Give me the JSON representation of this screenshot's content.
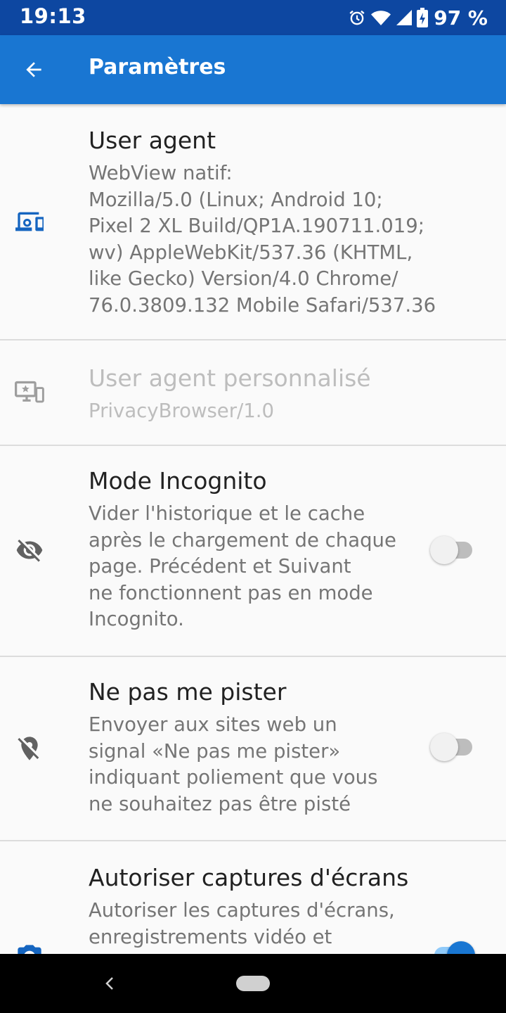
{
  "status_bar": {
    "time": "19:13",
    "battery_percent": "97 %",
    "icons": [
      "alarm-icon",
      "wifi-icon",
      "signal-icon",
      "battery-charging-icon"
    ]
  },
  "app_bar": {
    "title": "Paramètres",
    "back_icon": "arrow-back-icon"
  },
  "preferences": [
    {
      "id": "user-agent",
      "icon": "devices-icon",
      "title": "User agent",
      "summary_lines": [
        "WebView natif:",
        "Mozilla/5.0 (Linux; Android 10;",
        "Pixel 2 XL Build/QP1A.190711.019;",
        "wv) AppleWebKit/537.36 (KHTML,",
        "like Gecko) Version/4.0 Chrome/",
        "76.0.3809.132 Mobile Safari/537.36"
      ],
      "enabled": true
    },
    {
      "id": "custom-user-agent",
      "icon": "custom-devices-icon",
      "title": "User agent personnalisé",
      "summary_lines": [
        "PrivacyBrowser/1.0"
      ],
      "enabled": false
    },
    {
      "id": "incognito-mode",
      "icon": "visibility-off-icon",
      "title": "Mode Incognito",
      "summary_lines": [
        "Vider l'historique et le cache",
        "après le chargement de chaque",
        "page. Précédent et Suivant",
        "ne fonctionnent pas en mode",
        "Incognito."
      ],
      "switch_on": false
    },
    {
      "id": "do-not-track",
      "icon": "location-off-icon",
      "title": "Ne pas me pister",
      "summary_lines": [
        "Envoyer aux sites web un",
        "signal «Ne pas me pister»",
        "indiquant poliement que vous",
        "ne souhaitez pas être pisté"
      ],
      "switch_on": false
    },
    {
      "id": "allow-screenshots",
      "icon": "camera-icon",
      "title": "Autoriser captures d'écrans",
      "summary_lines": [
        "Autoriser les captures d'écrans,",
        "enregistrements vidéo et"
      ],
      "switch_on": true
    }
  ],
  "nav_bar": {
    "icons": [
      "nav-back-icon",
      "home-pill-icon"
    ]
  },
  "colors": {
    "status_bar": "#0d47a1",
    "app_bar": "#1976d2",
    "icon_blue": "#1565c0",
    "background": "#fafafa"
  }
}
